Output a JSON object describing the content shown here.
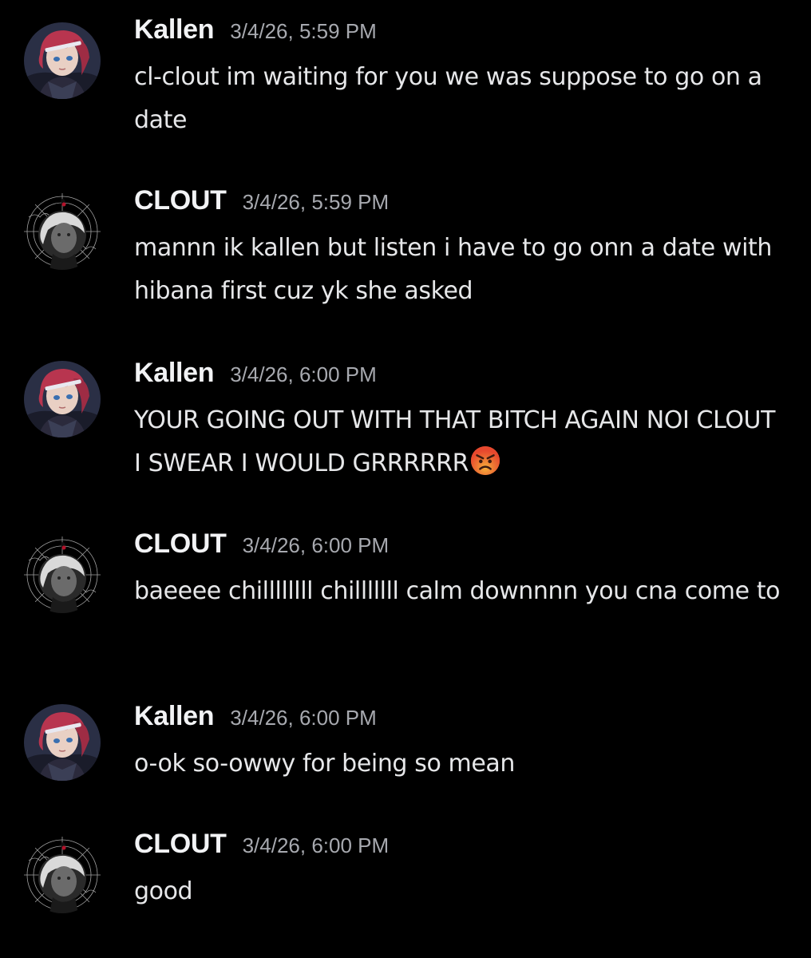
{
  "messages": [
    {
      "author": "Kallen",
      "timestamp": "3/4/26, 5:59 PM",
      "text": "cl-clout im waiting for you we was suppose to go on a date",
      "avatar": "kallen-avatar"
    },
    {
      "author": "CLOUT",
      "timestamp": "3/4/26, 5:59 PM",
      "text": "mannn ik kallen but listen i have to go onn a date with hibana first cuz yk she asked",
      "avatar": "clout-avatar"
    },
    {
      "author": "Kallen",
      "timestamp": "3/4/26, 6:00 PM",
      "text": "YOUR GOING OUT WITH THAT BITCH AGAIN NOI CLOUT I SWEAR I WOULD GRRRRRR",
      "emoji": "angry-face-emoji",
      "avatar": "kallen-avatar"
    },
    {
      "author": "CLOUT",
      "timestamp": "3/4/26, 6:00 PM",
      "text": "baeeee chillllllll chilllllll calm downnnn you cna come to",
      "avatar": "clout-avatar"
    },
    {
      "author": "Kallen",
      "timestamp": "3/4/26, 6:00 PM",
      "text": "o-ok so-owwy for being so mean",
      "avatar": "kallen-avatar"
    },
    {
      "author": "CLOUT",
      "timestamp": "3/4/26, 6:00 PM",
      "text": "good",
      "avatar": "clout-avatar"
    }
  ],
  "colors": {
    "background": "#000000",
    "username": "#f2f3f5",
    "timestamp": "#a7a9af",
    "message_text": "#e6e7e9"
  }
}
